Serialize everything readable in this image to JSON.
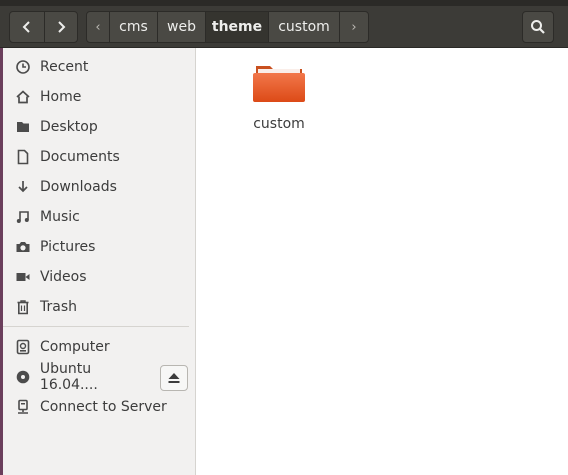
{
  "toolbar": {
    "back_icon": "chevron-left-icon",
    "forward_icon": "chevron-right-icon",
    "breadcrumb_prev_icon": "small-chevron-left-icon",
    "breadcrumb_next_icon": "small-chevron-right-icon",
    "search_icon": "search-icon",
    "breadcrumbs": [
      "cms",
      "web",
      "theme",
      "custom"
    ],
    "active_crumb": "theme"
  },
  "sidebar": {
    "places": [
      {
        "label": "Recent",
        "icon": "clock-icon"
      },
      {
        "label": "Home",
        "icon": "home-icon"
      },
      {
        "label": "Desktop",
        "icon": "desktop-folder-icon"
      },
      {
        "label": "Documents",
        "icon": "document-icon"
      },
      {
        "label": "Downloads",
        "icon": "download-arrow-icon"
      },
      {
        "label": "Music",
        "icon": "music-note-icon"
      },
      {
        "label": "Pictures",
        "icon": "camera-icon"
      },
      {
        "label": "Videos",
        "icon": "video-icon"
      },
      {
        "label": "Trash",
        "icon": "trash-icon"
      }
    ],
    "devices": [
      {
        "label": "Computer",
        "icon": "hard-drive-icon"
      },
      {
        "label": "Ubuntu 16.04....",
        "icon": "disc-icon",
        "eject_icon": "eject-icon"
      },
      {
        "label": "Connect to Server",
        "icon": "server-icon"
      }
    ]
  },
  "content": {
    "items": [
      {
        "label": "custom",
        "type": "folder",
        "icon": "folder-icon",
        "color": "#e95420"
      }
    ]
  },
  "colors": {
    "toolbar_bg": "#3c3b37",
    "sidebar_bg": "#f2f1f0",
    "folder_orange": "#e95420"
  }
}
